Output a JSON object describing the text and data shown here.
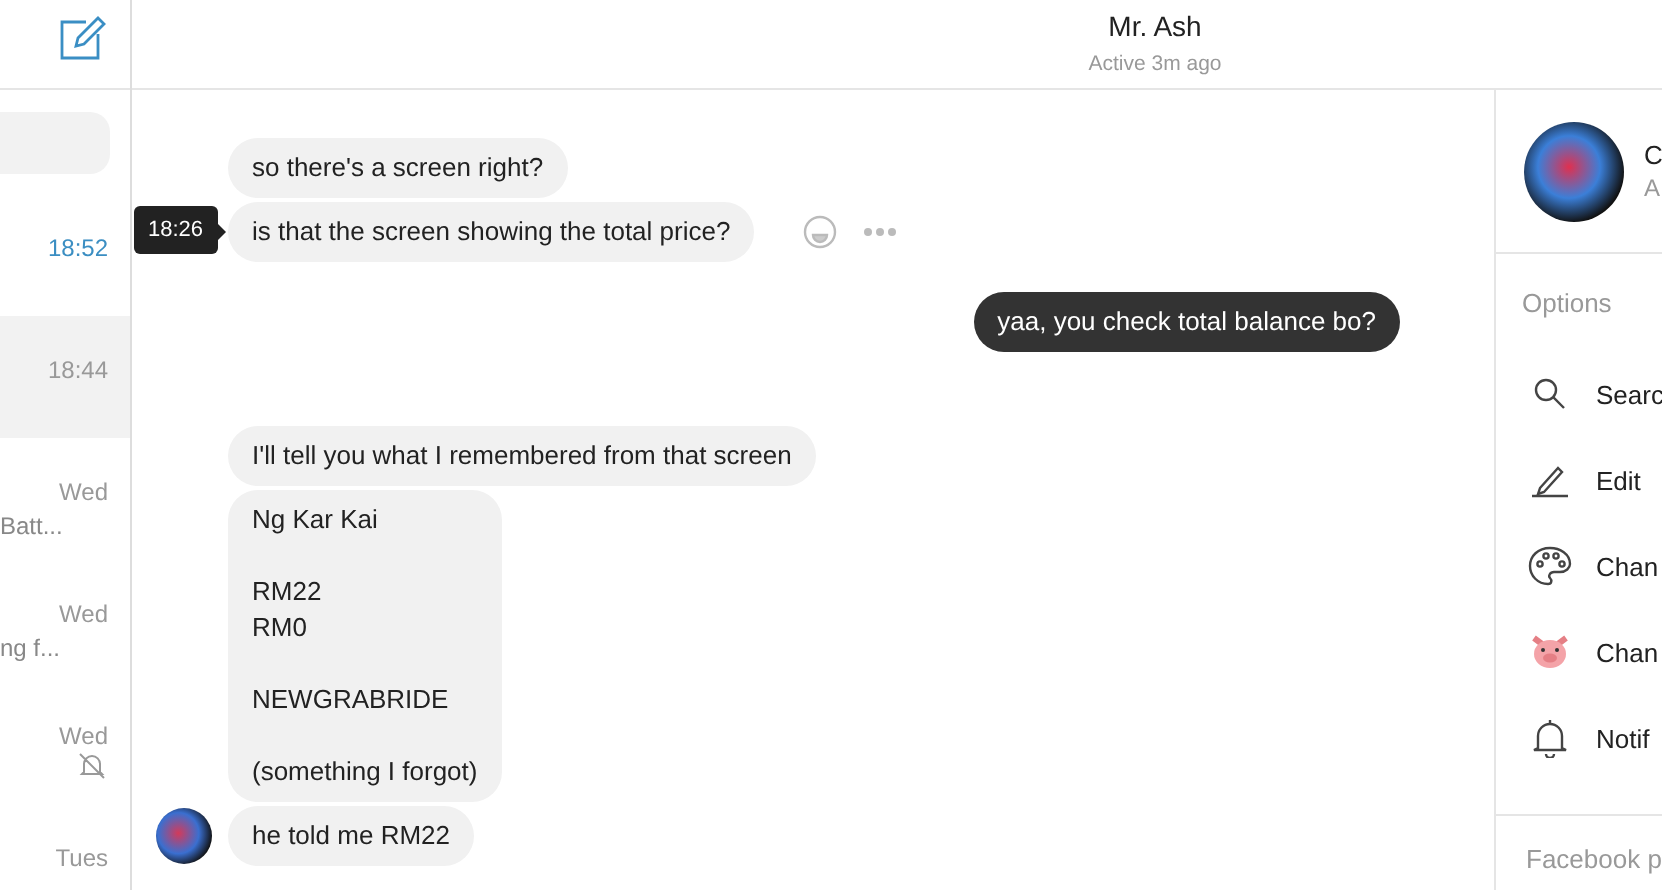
{
  "sidebar": {
    "conversations": [
      {
        "time": "18:52",
        "unread": true,
        "selected": false,
        "muted": false
      },
      {
        "time": "18:44",
        "unread": false,
        "selected": true,
        "muted": false
      },
      {
        "time": "Wed",
        "snippet": "Batt...",
        "unread": false,
        "selected": false,
        "muted": false
      },
      {
        "time": "Wed",
        "snippet": "ng f...",
        "unread": false,
        "selected": false,
        "muted": false
      },
      {
        "time": "Wed",
        "unread": false,
        "selected": false,
        "muted": true
      },
      {
        "time": "Tues",
        "unread": false,
        "selected": false,
        "muted": false
      }
    ]
  },
  "header": {
    "title": "Mr. Ash",
    "status": "Active 3m ago"
  },
  "messages": [
    {
      "kind": "incoming",
      "text": "so there's a screen right?",
      "hovered": false,
      "avatar": false
    },
    {
      "kind": "incoming",
      "text": "is that the screen showing the total price?",
      "timestamp": "18:26",
      "hovered": true,
      "avatar": false
    },
    {
      "kind": "outgoing",
      "text": "yaa, you check total balance bo?",
      "hovered": false,
      "avatar": false
    },
    {
      "kind": "incoming",
      "text": "I'll tell you what I remembered from that screen",
      "hovered": false,
      "avatar": false
    },
    {
      "kind": "incoming",
      "text": "Ng Kar Kai\n\nRM22\nRM0\n\nNEWGRABRIDE\n\n(something I forgot)",
      "hovered": false,
      "avatar": false
    },
    {
      "kind": "incoming",
      "text": "he told me RM22",
      "hovered": false,
      "avatar": true
    }
  ],
  "details": {
    "name": "C",
    "subtitle": "A",
    "options_heading": "Options",
    "options": [
      {
        "kind": "search",
        "label": "Searc"
      },
      {
        "kind": "edit",
        "label": "Edit"
      },
      {
        "kind": "theme",
        "label": "Chan"
      },
      {
        "kind": "emoji",
        "label": "Chan"
      },
      {
        "kind": "notifications",
        "label": "Notif"
      }
    ],
    "footer_heading": "Facebook p"
  }
}
